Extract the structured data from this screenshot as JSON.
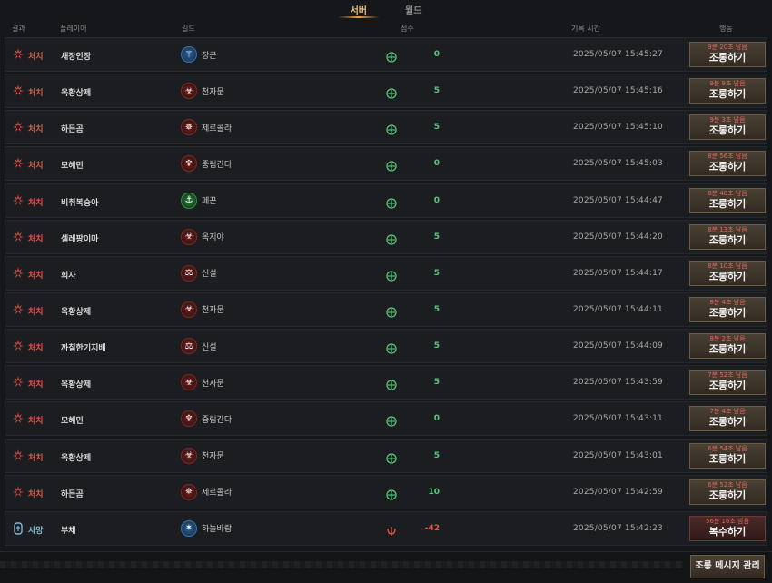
{
  "tabs": [
    {
      "label": "서버",
      "active": true
    },
    {
      "label": "월드",
      "active": false
    }
  ],
  "columns": {
    "result": "결과",
    "player": "플레이어",
    "guild": "길드",
    "score": "점수",
    "time": "기록 시간",
    "action": "행동"
  },
  "rows": [
    {
      "result": "처치",
      "type": "kill",
      "player": "새장인장",
      "guild": "장군",
      "guild_color": "blue",
      "guild_glyph": "⚚",
      "score": "0",
      "time": "2025/05/07 15:45:27",
      "remaining": "9분 20초 남음",
      "action": "조롱하기"
    },
    {
      "result": "처치",
      "type": "kill",
      "player": "옥황상제",
      "guild": "천자문",
      "guild_color": "red",
      "guild_glyph": "☣",
      "score": "5",
      "time": "2025/05/07 15:45:16",
      "remaining": "9분 9초 남음",
      "action": "조롱하기"
    },
    {
      "result": "처치",
      "type": "kill",
      "player": "하든곰",
      "guild": "제로콜라",
      "guild_color": "red",
      "guild_glyph": "✵",
      "score": "5",
      "time": "2025/05/07 15:45:10",
      "remaining": "9분 3초 남음",
      "action": "조롱하기"
    },
    {
      "result": "처치",
      "type": "kill",
      "player": "모혜민",
      "guild": "중림간다",
      "guild_color": "red",
      "guild_glyph": "♆",
      "score": "0",
      "time": "2025/05/07 15:45:03",
      "remaining": "8분 56초 남음",
      "action": "조롱하기"
    },
    {
      "result": "처치",
      "type": "kill",
      "player": "비취복숭아",
      "guild": "페끈",
      "guild_color": "green",
      "guild_glyph": "⚓",
      "score": "0",
      "time": "2025/05/07 15:44:47",
      "remaining": "8분 40초 남음",
      "action": "조롱하기"
    },
    {
      "result": "처치",
      "type": "kill",
      "player": "셀레팡이마",
      "guild": "옥지야",
      "guild_color": "red",
      "guild_glyph": "☣",
      "score": "5",
      "time": "2025/05/07 15:44:20",
      "remaining": "8분 13초 남음",
      "action": "조롱하기"
    },
    {
      "result": "처치",
      "type": "kill",
      "player": "희자",
      "guild": "신설",
      "guild_color": "red",
      "guild_glyph": "⚖",
      "score": "5",
      "time": "2025/05/07 15:44:17",
      "remaining": "8분 10초 남음",
      "action": "조롱하기"
    },
    {
      "result": "처치",
      "type": "kill",
      "player": "옥황상제",
      "guild": "천자문",
      "guild_color": "red",
      "guild_glyph": "☣",
      "score": "5",
      "time": "2025/05/07 15:44:11",
      "remaining": "8분 4초 남음",
      "action": "조롱하기"
    },
    {
      "result": "처치",
      "type": "kill",
      "player": "까칠한기지배",
      "guild": "신설",
      "guild_color": "red",
      "guild_glyph": "⚖",
      "score": "5",
      "time": "2025/05/07 15:44:09",
      "remaining": "8분 2초 남음",
      "action": "조롱하기"
    },
    {
      "result": "처치",
      "type": "kill",
      "player": "옥황상제",
      "guild": "천자문",
      "guild_color": "red",
      "guild_glyph": "☣",
      "score": "5",
      "time": "2025/05/07 15:43:59",
      "remaining": "7분 52초 남음",
      "action": "조롱하기"
    },
    {
      "result": "처치",
      "type": "kill",
      "player": "모혜민",
      "guild": "중림간다",
      "guild_color": "red",
      "guild_glyph": "♆",
      "score": "0",
      "time": "2025/05/07 15:43:11",
      "remaining": "7분 4초 남음",
      "action": "조롱하기"
    },
    {
      "result": "처치",
      "type": "kill",
      "player": "옥황상제",
      "guild": "천자문",
      "guild_color": "red",
      "guild_glyph": "☣",
      "score": "5",
      "time": "2025/05/07 15:43:01",
      "remaining": "6분 54초 남음",
      "action": "조롱하기"
    },
    {
      "result": "처치",
      "type": "kill",
      "player": "하든곰",
      "guild": "제로콜라",
      "guild_color": "red",
      "guild_glyph": "✵",
      "score": "10",
      "time": "2025/05/07 15:42:59",
      "remaining": "6분 52초 남음",
      "action": "조롱하기"
    },
    {
      "result": "사망",
      "type": "death",
      "player": "부채",
      "guild": "하늘바람",
      "guild_color": "blue",
      "guild_glyph": "✶",
      "score": "-42",
      "time": "2025/05/07 15:42:23",
      "remaining": "56분 16초 남음",
      "action": "복수하기"
    }
  ],
  "footer": {
    "manage_label": "조롱 메시지 관리"
  }
}
